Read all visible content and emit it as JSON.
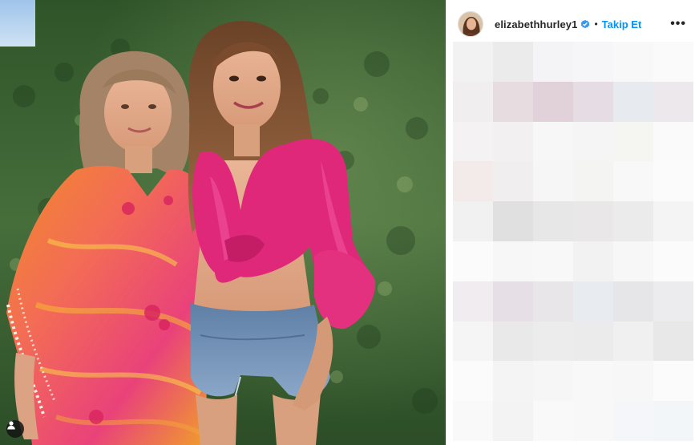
{
  "post": {
    "username": "elizabethhurley1",
    "verified": true,
    "separator": "•",
    "follow_label": "Takip Et",
    "more_label": "•••"
  },
  "photo": {
    "people_count": 2,
    "tagged_people_icon": "user-tag-icon"
  },
  "comments_area": {
    "state": "pixelated/blurred",
    "mosaic_colors": [
      [
        "#f3f2f3",
        "#ecebec",
        "#f4f4f6",
        "#f6f6f8",
        "#f8f8f8",
        "#fafafa"
      ],
      [
        "#f1eeef",
        "#e7dde1",
        "#e0d2d8",
        "#e5dde3",
        "#e7eaee",
        "#ece8ec"
      ],
      [
        "#f5f2f3",
        "#f2f0f1",
        "#f7f7f7",
        "#f5f5f5",
        "#f5f5f2",
        "#fafafa"
      ],
      [
        "#f3ebea",
        "#f0eeee",
        "#f6f6f6",
        "#f4f4f2",
        "#f8f8f8",
        "#fbfbfb"
      ],
      [
        "#f1f1f1",
        "#e0e0e1",
        "#e7e7e8",
        "#e9e7e8",
        "#ebebec",
        "#f4f4f4"
      ],
      [
        "#fbfbfb",
        "#f7f7f7",
        "#f8f8f8",
        "#f2f2f2",
        "#f7f7f7",
        "#fbfbfb"
      ],
      [
        "#f0ecf0",
        "#e6dfe5",
        "#e9e6ea",
        "#e8ecf1",
        "#e6e6e8",
        "#ececee"
      ],
      [
        "#f5f5f5",
        "#e9e9ea",
        "#ececec",
        "#ebebeb",
        "#f0f0f0",
        "#e8e8e8"
      ],
      [
        "#fbfbfb",
        "#f4f4f4",
        "#f6f6f6",
        "#f8f8f8",
        "#f7f7f7",
        "#fbfbfb"
      ],
      [
        "#f9f9f9",
        "#f3f3f3",
        "#f9f9f9",
        "#f8f8f8",
        "#f4f6fa",
        "#f2f6f9"
      ]
    ]
  },
  "colors": {
    "follow_blue": "#0095f6",
    "verified_blue": "#3897f0",
    "text_dark": "#262626",
    "hedge_green": "#3f6a3a"
  }
}
